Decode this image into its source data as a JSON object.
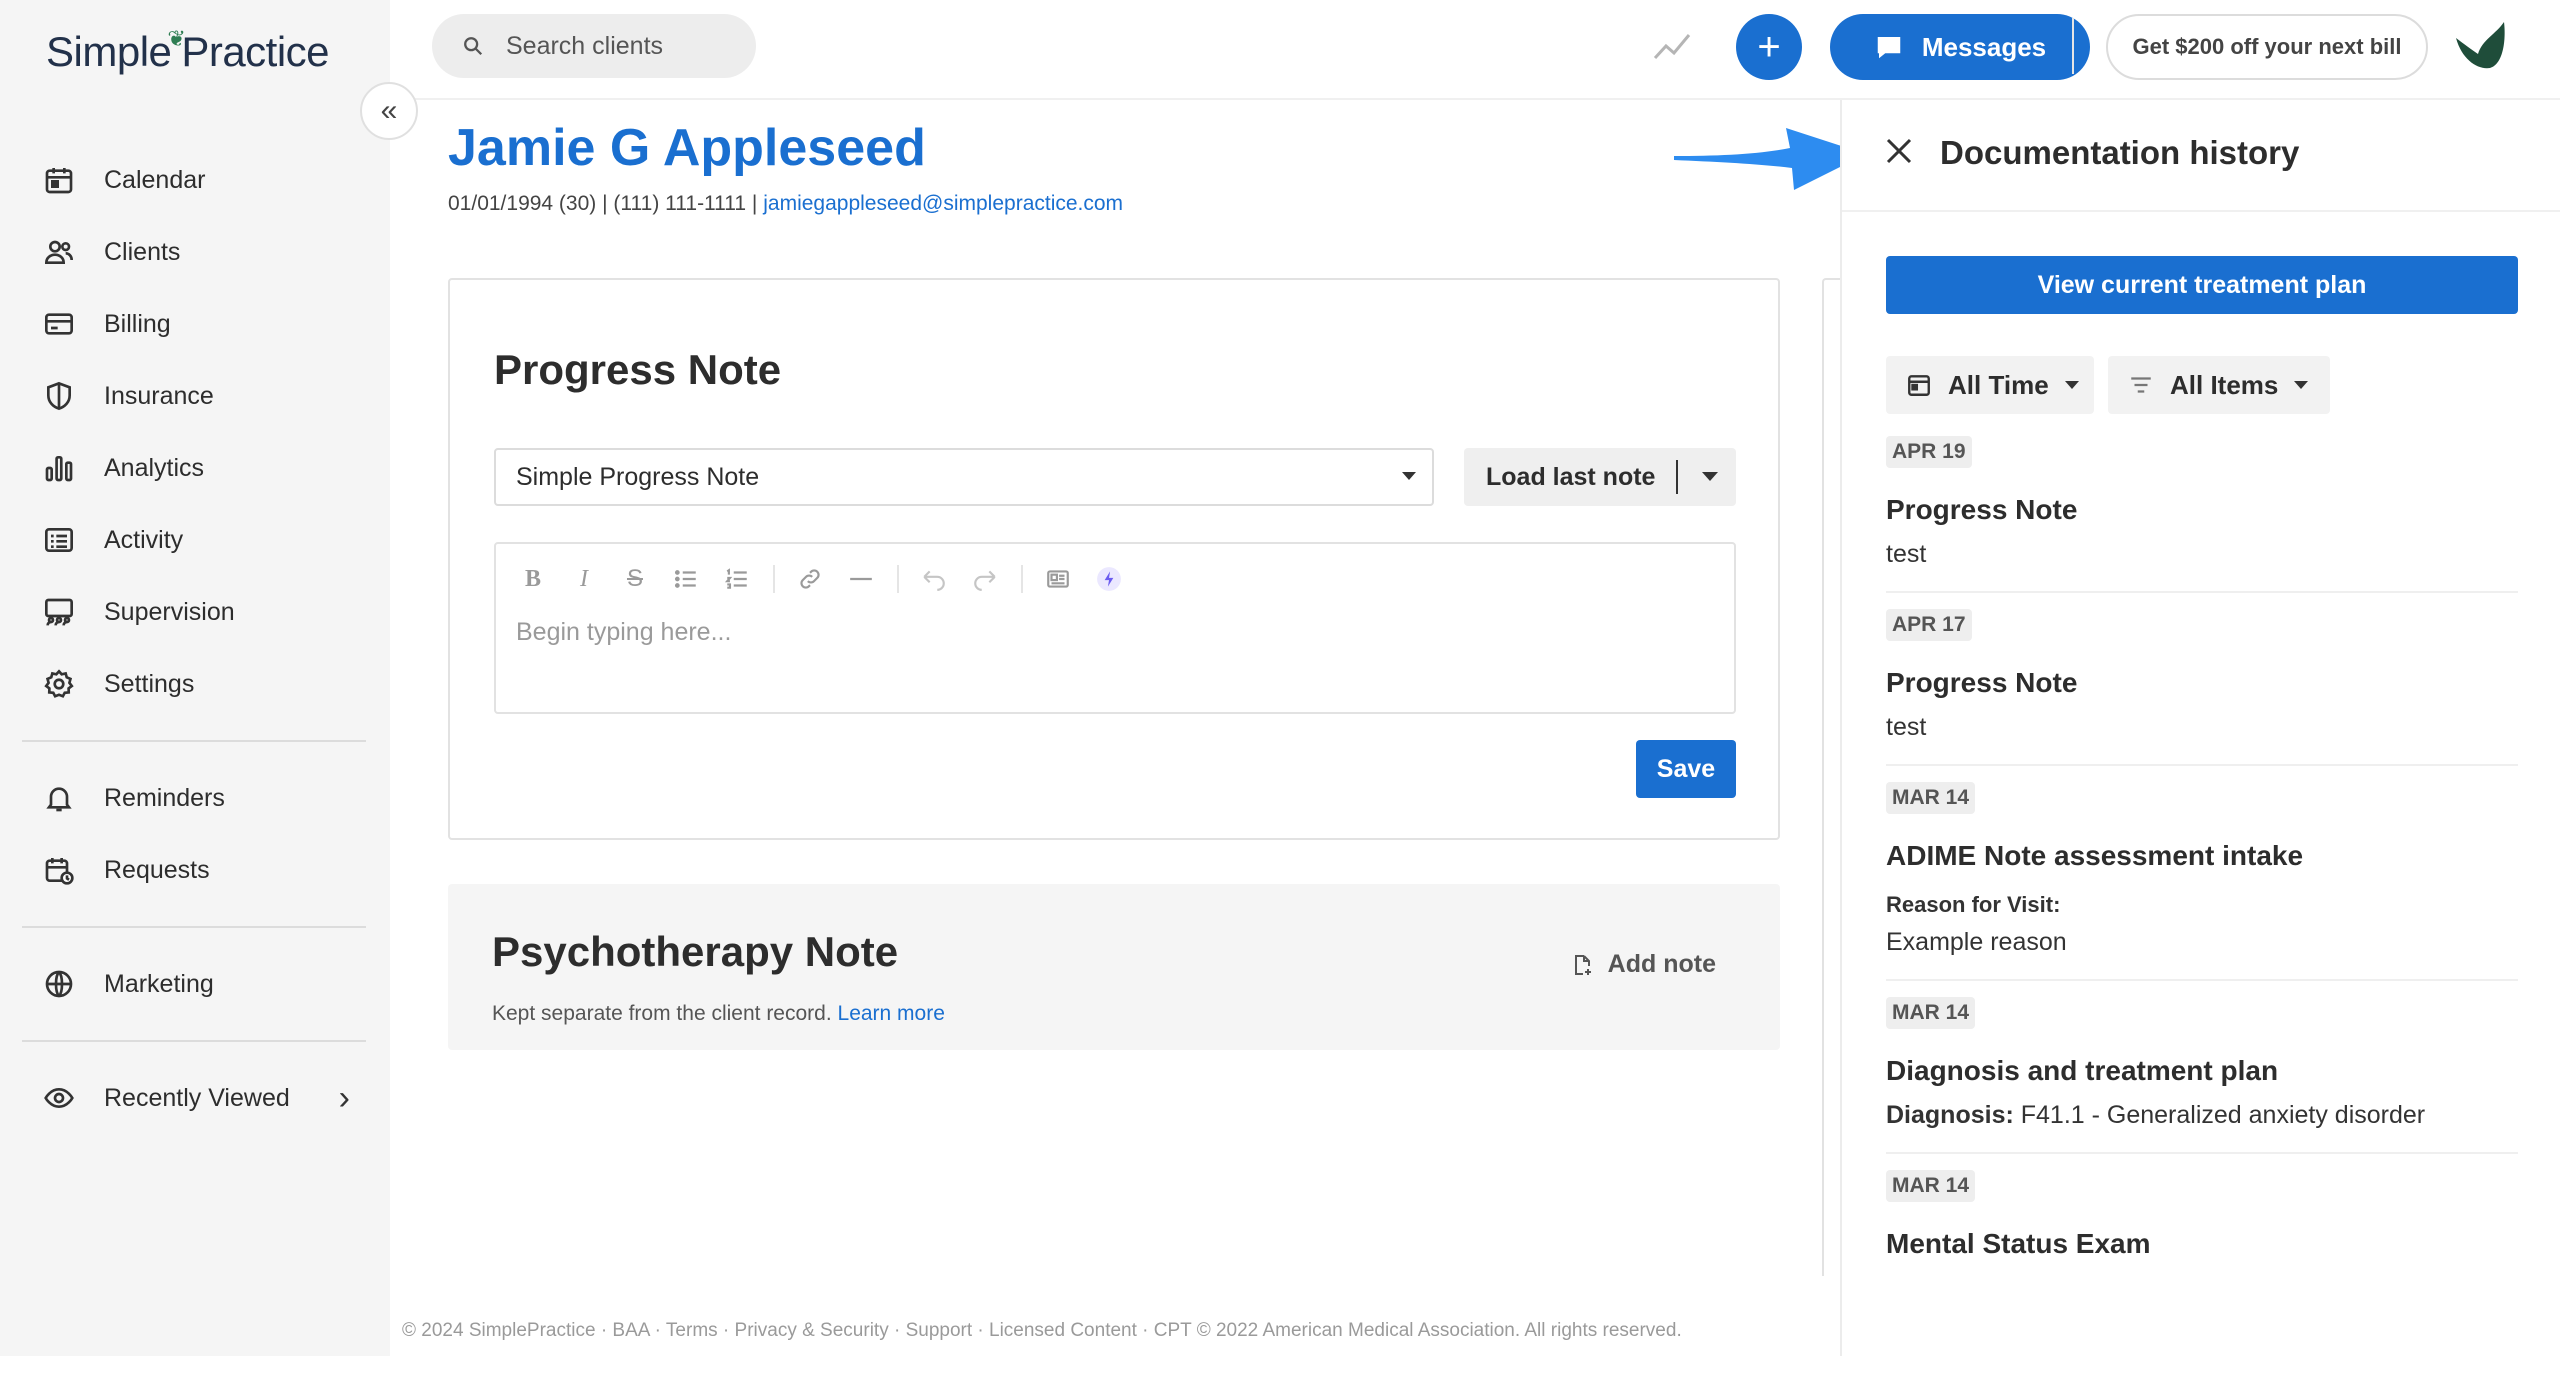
{
  "brand": {
    "logo_left": "Simple",
    "logo_right": "Practice"
  },
  "sidebar": {
    "items": [
      {
        "label": "Calendar",
        "icon": "calendar-icon"
      },
      {
        "label": "Clients",
        "icon": "clients-icon"
      },
      {
        "label": "Billing",
        "icon": "billing-icon"
      },
      {
        "label": "Insurance",
        "icon": "insurance-icon"
      },
      {
        "label": "Analytics",
        "icon": "analytics-icon"
      },
      {
        "label": "Activity",
        "icon": "activity-icon"
      },
      {
        "label": "Supervision",
        "icon": "supervision-icon"
      },
      {
        "label": "Settings",
        "icon": "settings-icon"
      }
    ],
    "secondary": [
      {
        "label": "Reminders",
        "icon": "bell-icon"
      },
      {
        "label": "Requests",
        "icon": "requests-icon"
      }
    ],
    "marketing": {
      "label": "Marketing",
      "icon": "globe-icon"
    },
    "recent": {
      "label": "Recently Viewed",
      "icon": "eye-icon"
    }
  },
  "topbar": {
    "search_placeholder": "Search clients",
    "messages_label": "Messages",
    "promo_label": "Get $200 off your next bill",
    "brand_color": "#1a6fd0"
  },
  "client": {
    "name": "Jamie G Appleseed",
    "meta": "01/01/1994 (30) | (111) 111-1111 | ",
    "email": "jamiegappleseed@simplepractice.com"
  },
  "progress_note": {
    "title": "Progress Note",
    "template": "Simple Progress Note",
    "load_label": "Load last note",
    "editor_placeholder": "Begin typing here...",
    "save_label": "Save"
  },
  "psychotherapy_note": {
    "title": "Psychotherapy Note",
    "subtitle": "Kept separate from the client record.",
    "learn_more": "Learn more",
    "add_label": "Add note"
  },
  "footer": "© 2024 SimplePractice · BAA · Terms · Privacy & Security · Support · Licensed Content · CPT © 2022 American Medical Association. All rights reserved.",
  "panel": {
    "title": "Documentation history",
    "plan_button": "View current treatment plan",
    "filter_time": "All Time",
    "filter_items": "All Items",
    "entries": [
      {
        "date": "APR 19",
        "title": "Progress Note",
        "text": "test"
      },
      {
        "date": "APR 17",
        "title": "Progress Note",
        "text": "test"
      },
      {
        "date": "MAR 14",
        "title": "ADIME Note assessment intake",
        "label": "Reason for Visit:",
        "text": "Example reason"
      },
      {
        "date": "MAR 14",
        "title": "Diagnosis and treatment plan",
        "label_inline": "Diagnosis:",
        "text": " F41.1 - Generalized anxiety disorder"
      },
      {
        "date": "MAR 14",
        "title": "Mental Status Exam"
      }
    ]
  }
}
